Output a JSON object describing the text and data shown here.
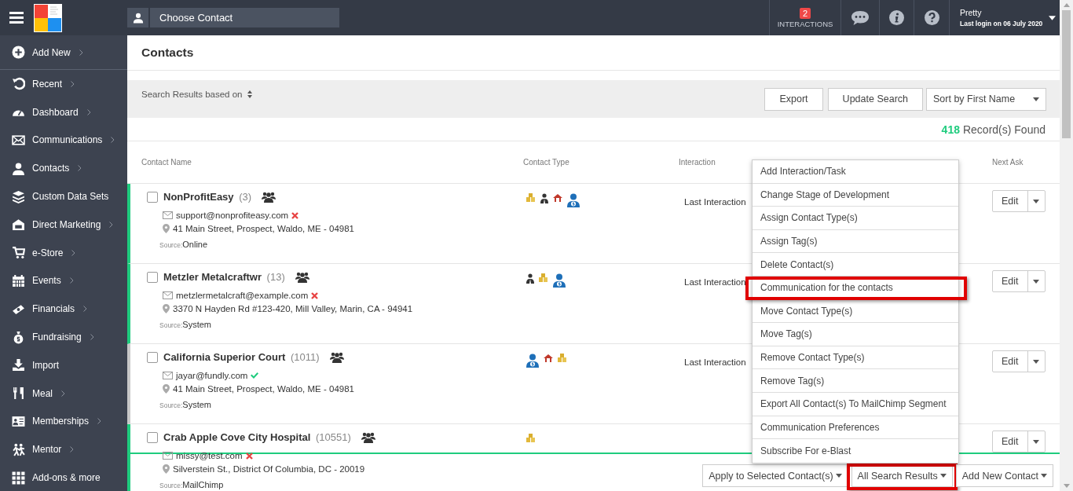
{
  "topbar": {
    "contact_search": {
      "placeholder": "Choose Contact"
    },
    "interactions": {
      "count": "2",
      "label": "INTERACTIONS"
    },
    "user": {
      "name": "Pretty",
      "last_login": "Last login on 06 July 2020"
    }
  },
  "sidebar": {
    "add_new": {
      "label": "Add New",
      "has_submenu": true
    },
    "items": [
      {
        "label": "Recent",
        "has_submenu": true
      },
      {
        "label": "Dashboard",
        "has_submenu": true
      },
      {
        "label": "Communications",
        "has_submenu": true
      },
      {
        "label": "Contacts",
        "has_submenu": true
      },
      {
        "label": "Custom Data Sets",
        "has_submenu": false
      },
      {
        "label": "Direct Marketing",
        "has_submenu": true
      },
      {
        "label": "e-Store",
        "has_submenu": true
      },
      {
        "label": "Events",
        "has_submenu": true
      },
      {
        "label": "Financials",
        "has_submenu": true
      },
      {
        "label": "Fundraising",
        "has_submenu": true
      },
      {
        "label": "Import",
        "has_submenu": false
      },
      {
        "label": "Meal",
        "has_submenu": true
      },
      {
        "label": "Memberships",
        "has_submenu": true
      },
      {
        "label": "Mentor",
        "has_submenu": true
      },
      {
        "label": "Add-ons & more",
        "has_submenu": false
      }
    ]
  },
  "page_title": "Contacts",
  "search_bar": {
    "label": "Search Results based on",
    "buttons": [
      "Export",
      "Update Search"
    ],
    "sort": {
      "value": "Sort by First Name"
    }
  },
  "records": {
    "count": "418",
    "label": "Record(s) Found"
  },
  "table": {
    "columns": [
      "Contact Name",
      "Contact Type",
      "Interaction",
      "Next Ask"
    ],
    "rows": [
      {
        "name": "**NonProfitEasy** (3)",
        "email": "support@nonprofiteasy.com",
        "email_valid": false,
        "address": "41 Main Street, Prospect, Waldo, ME - 04981",
        "source_label": "Source:",
        "source": "Online",
        "color": "#1fcc7e",
        "checked": false,
        "contact_types": [
          {
            "kind": "coins"
          },
          {
            "kind": "person"
          },
          {
            "kind": "house"
          },
          {
            "kind": "donor"
          }
        ],
        "interaction": "Last Interaction",
        "action": "Edit"
      },
      {
        "name": "**Metzler Metalcraftwr** (13)",
        "email": "metzlermetalcraft@example.com",
        "email_valid": false,
        "address": "3370 N Hayden Rd #123-420, Mill Valley, Marin, CA - 94941",
        "source_label": "Source:",
        "source": "System",
        "color": "#1fcc7e",
        "checked": false,
        "contact_types": [
          {
            "kind": "person"
          },
          {
            "kind": "coins"
          },
          {
            "kind": "donor"
          }
        ],
        "interaction": "Last Interaction",
        "action": "Edit"
      },
      {
        "name": "**California Superior Court** (1011)",
        "email": "jayar@fundly.com",
        "email_valid": true,
        "address": "41 Main Street, Prospect, Waldo, ME - 04981",
        "source_label": "Source:",
        "source": "System",
        "color": "#c8c8c8",
        "checked": false,
        "contact_types": [
          {
            "kind": "donor"
          },
          {
            "kind": "house"
          },
          {
            "kind": "coins"
          }
        ],
        "interaction": "Last Interaction",
        "action": "Edit"
      },
      {
        "name": "**Crab Apple Cove City Hospital** (10551)",
        "email": "missy@test.com",
        "email_valid": false,
        "address": "Silverstein St., District Of Columbia, DC - 20019",
        "source_label": "Source:",
        "source": "MailChimp",
        "color": "#1fcc7e",
        "checked": false,
        "contact_types": [
          {
            "kind": "coins"
          }
        ],
        "action": "Edit"
      }
    ]
  },
  "action_menu": {
    "items": [
      {
        "label": "Add Interaction/Task",
        "highlighted": false
      },
      {
        "label": "Change Stage of Development",
        "highlighted": false
      },
      {
        "label": "Assign Contact Type(s)",
        "highlighted": false
      },
      {
        "label": "Assign Tag(s)",
        "highlighted": false
      },
      {
        "label": "Delete Contact(s)",
        "highlighted": false
      },
      {
        "label": "Communication for the contacts",
        "highlighted": true
      },
      {
        "label": "Move Contact Type(s)",
        "highlighted": false
      },
      {
        "label": "Move Tag(s)",
        "highlighted": false
      },
      {
        "label": "Remove Contact Type(s)",
        "highlighted": false
      },
      {
        "label": "Remove Tag(s)",
        "highlighted": false
      },
      {
        "label": "Export All Contact(s) To MailChimp Segment",
        "highlighted": false
      },
      {
        "label": "Communication Preferences",
        "highlighted": false
      },
      {
        "label": "Subscribe For e-Blast",
        "highlighted": false
      }
    ]
  },
  "bottom_actions": [
    {
      "label": "Apply to Selected Contact(s)",
      "highlighted": false
    },
    {
      "label": "All Search Results",
      "highlighted": true
    },
    {
      "label": "Add New Contact",
      "highlighted": false
    }
  ]
}
